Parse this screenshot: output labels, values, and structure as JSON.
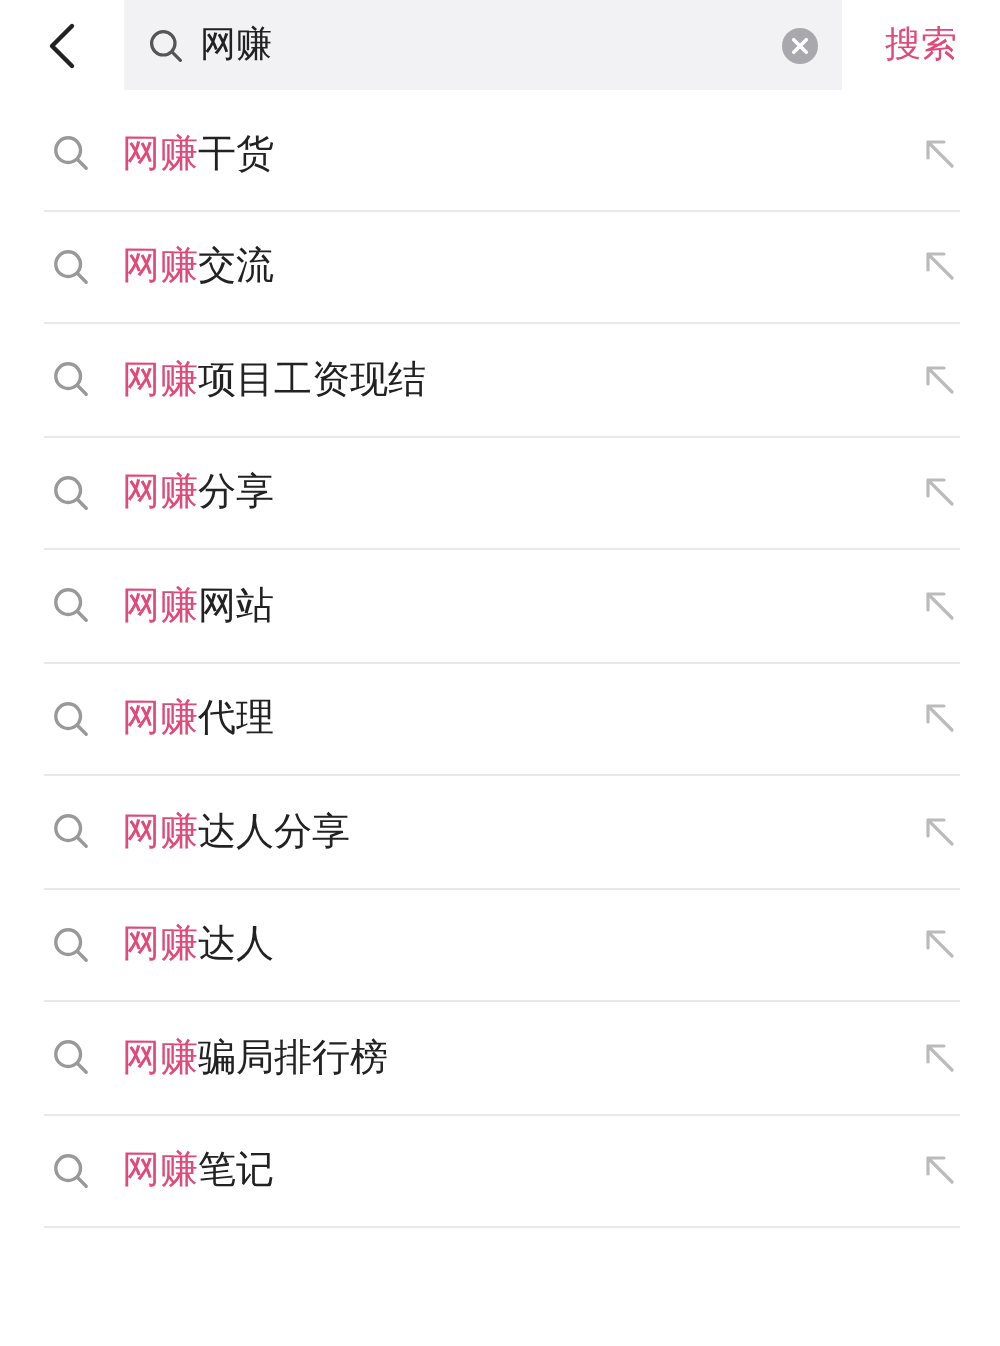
{
  "search": {
    "value": "网赚",
    "submit": "搜索"
  },
  "suggestions": [
    {
      "match": "网赚",
      "rest": "干货"
    },
    {
      "match": "网赚",
      "rest": "交流"
    },
    {
      "match": "网赚",
      "rest": "项目工资现结"
    },
    {
      "match": "网赚",
      "rest": "分享"
    },
    {
      "match": "网赚",
      "rest": "网站"
    },
    {
      "match": "网赚",
      "rest": "代理"
    },
    {
      "match": "网赚",
      "rest": "达人分享"
    },
    {
      "match": "网赚",
      "rest": "达人"
    },
    {
      "match": "网赚",
      "rest": "骗局排行榜"
    },
    {
      "match": "网赚",
      "rest": "笔记"
    }
  ]
}
